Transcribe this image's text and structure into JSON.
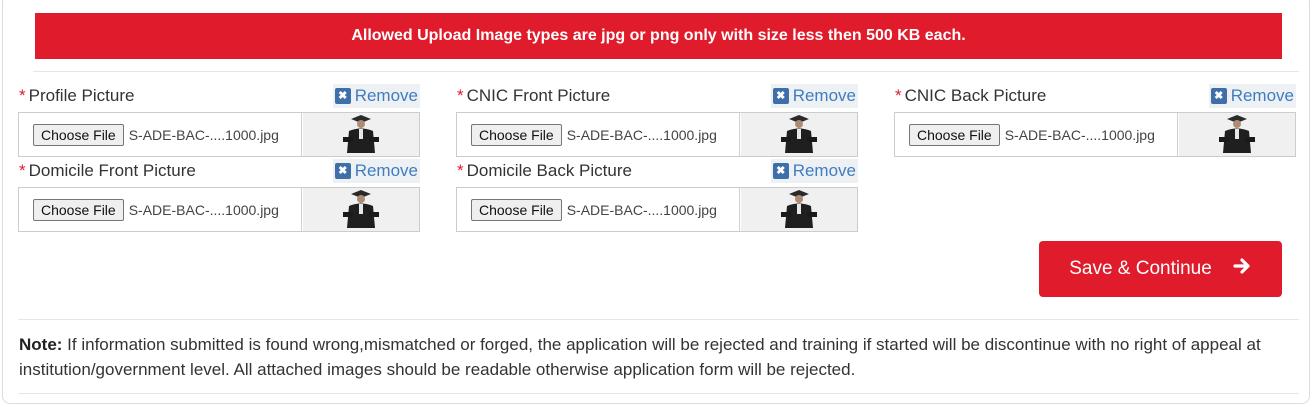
{
  "banner": {
    "text": "Allowed Upload Image types are jpg or png only with size less then 500 KB each."
  },
  "fields": [
    {
      "required_mark": "*",
      "label": "Profile Picture",
      "remove_label": "Remove",
      "choose_label": "Choose File",
      "file_name": "S-ADE-BAC-....1000.jpg",
      "thumb_icon": "graduate-photo-icon"
    },
    {
      "required_mark": "*",
      "label": "CNIC Front Picture",
      "remove_label": "Remove",
      "choose_label": "Choose File",
      "file_name": "S-ADE-BAC-....1000.jpg",
      "thumb_icon": "graduate-photo-icon"
    },
    {
      "required_mark": "*",
      "label": "CNIC Back Picture",
      "remove_label": "Remove",
      "choose_label": "Choose File",
      "file_name": "S-ADE-BAC-....1000.jpg",
      "thumb_icon": "graduate-photo-icon"
    },
    {
      "required_mark": "*",
      "label": "Domicile Front Picture",
      "remove_label": "Remove",
      "choose_label": "Choose File",
      "file_name": "S-ADE-BAC-....1000.jpg",
      "thumb_icon": "graduate-photo-icon"
    },
    {
      "required_mark": "*",
      "label": "Domicile Back Picture",
      "remove_label": "Remove",
      "choose_label": "Choose File",
      "file_name": "S-ADE-BAC-....1000.jpg",
      "thumb_icon": "graduate-photo-icon"
    }
  ],
  "save_button": {
    "label": "Save & Continue",
    "icon": "arrow-right-icon"
  },
  "note": {
    "label": "Note:",
    "text": " If information submitted is found wrong,mismatched or forged, the application will be rejected and training if started will be discontinue with no right of appeal at institution/government level. All attached images should be readable otherwise application form will be rejected."
  },
  "colors": {
    "brand_red": "#e01b2b",
    "link_blue": "#3f7cc0"
  }
}
